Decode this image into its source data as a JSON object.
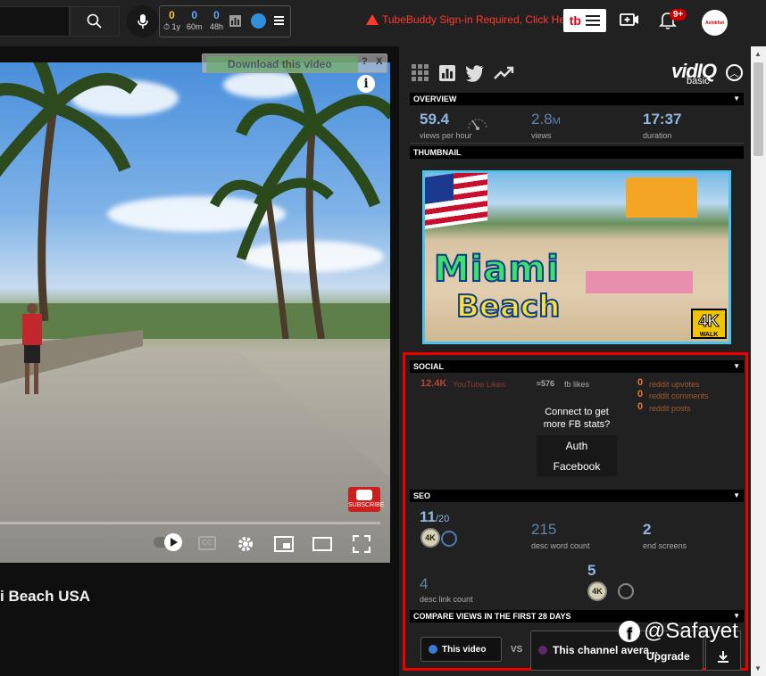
{
  "topbar": {
    "tubebuddy_stats": [
      {
        "value": "0",
        "label": "1y",
        "color": "#f5c242"
      },
      {
        "value": "0",
        "label": "60m",
        "color": "#5aa6ff"
      },
      {
        "value": "0",
        "label": "48h",
        "color": "#5aa6ff"
      }
    ],
    "warning_text": "TubeBuddy Sign-in Required, Click Here",
    "notification_count": "9+",
    "avatar_text": "Ashikfiet"
  },
  "video": {
    "download_label": "Download this video",
    "download_help": "?",
    "download_close": "X",
    "subscribe_label": "SUBSCRIBE",
    "title": "i Beach USA"
  },
  "vidiq": {
    "logo_text": "vidIQ",
    "plan_label": "basic",
    "overview": {
      "header": "OVERVIEW",
      "views_per_hour": "59.4",
      "views_per_hour_label": "views per hour",
      "views": "2.8",
      "views_suffix": "M",
      "views_label": "views",
      "duration": "17:37",
      "duration_label": "duration"
    },
    "thumbnail": {
      "header": "THUMBNAIL",
      "title_line1": "Miami",
      "title_line2": "Beach",
      "badge": "4K",
      "badge_sub": "WALK"
    },
    "social": {
      "header": "SOCIAL",
      "youtube_likes": "12.4K",
      "youtube_likes_label": "YouTube Likes",
      "fb_likes": "≈576",
      "fb_likes_label": "fb likes",
      "reddit": [
        {
          "value": "0",
          "label": "reddit upvotes"
        },
        {
          "value": "0",
          "label": "reddit comments"
        },
        {
          "value": "0",
          "label": "reddit posts"
        }
      ],
      "connect_text_1": "Connect to get",
      "connect_text_2": "more FB stats?",
      "auth_line1": "Auth",
      "auth_line2": "Facebook"
    },
    "seo": {
      "header": "SEO",
      "score": "11",
      "score_max": "/20",
      "desc_word_count": "215",
      "desc_word_count_label": "desc word count",
      "end_screens": "2",
      "end_screens_label": "end screens",
      "desc_link_count": "4",
      "desc_link_count_label": "desc link count",
      "tag_count": "5",
      "badge_text": "4K"
    },
    "compare": {
      "header": "COMPARE VIEWS IN THE FIRST 28 DAYS",
      "this_video": "This video",
      "vs": "VS",
      "channel_avg": "This channel avera...",
      "upgrade": "Upgrade"
    }
  },
  "watermark": "@Safayet",
  "colors": {
    "accent_blue": "#8fb7e6",
    "youtube_red": "#b8443a",
    "reddit_orange": "#e8772e",
    "frame_red": "#e00000",
    "thumb_border": "#49c3ed"
  }
}
